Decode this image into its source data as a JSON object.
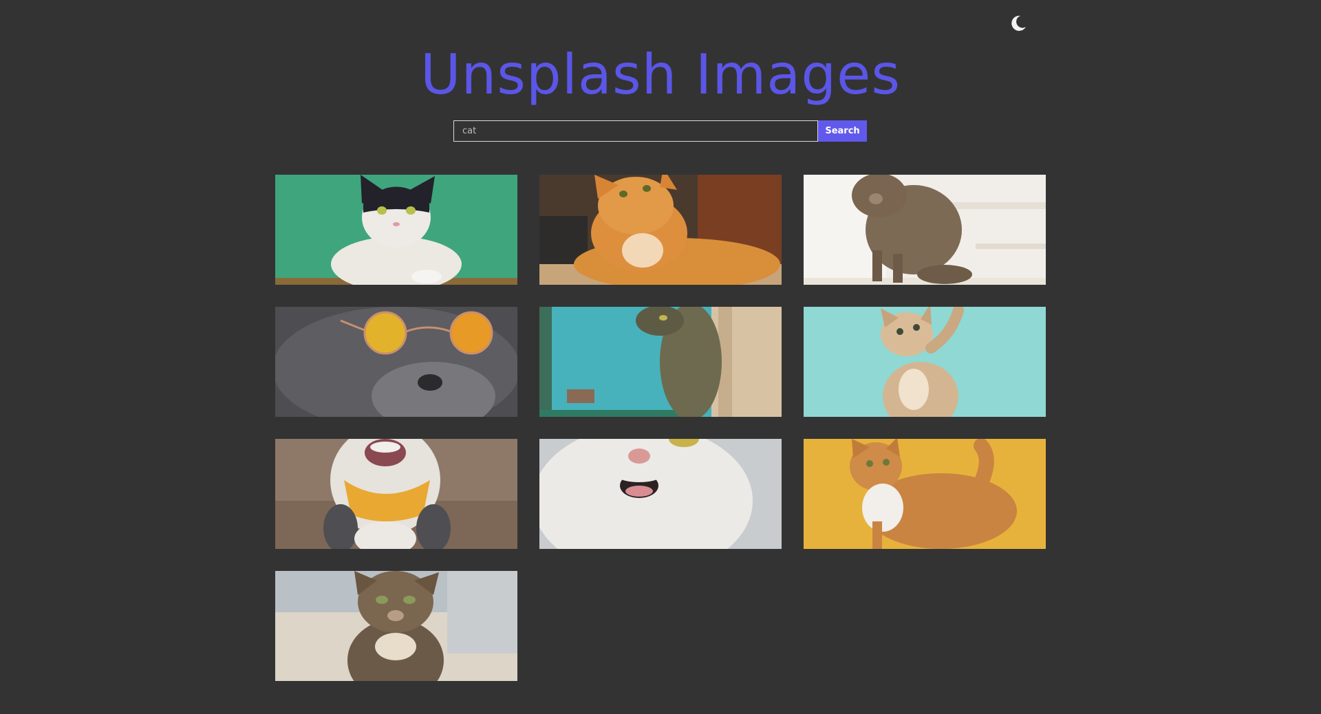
{
  "header": {
    "title": "Unsplash Images",
    "theme_toggle_icon": "moon-icon"
  },
  "search": {
    "value": "cat",
    "button_label": "Search"
  },
  "colors": {
    "background": "#333333",
    "accent": "#5b56e8",
    "button": "#6159ec"
  },
  "results": [
    {
      "label": "black and white cat on green background"
    },
    {
      "label": "orange tabby cat looking up"
    },
    {
      "label": "brown tabby cat sitting on stairs"
    },
    {
      "label": "gray cat wearing round sunglasses"
    },
    {
      "label": "cat peeking behind window frame"
    },
    {
      "label": "kitten reaching up on teal background"
    },
    {
      "label": "cat with yellow bandana"
    },
    {
      "label": "white cat with open mouth"
    },
    {
      "label": "orange cat on yellow background"
    },
    {
      "label": "tabby kitten close-up"
    }
  ]
}
